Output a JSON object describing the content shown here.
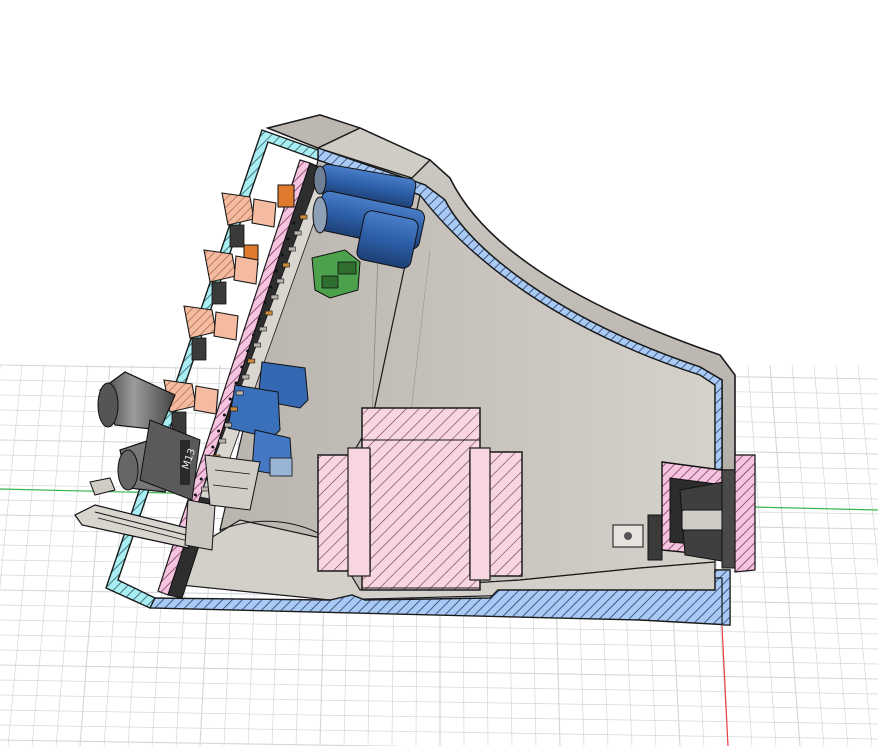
{
  "scene": {
    "kind": "cad-section-view",
    "colors": {
      "background": "#ffffff",
      "grid_line": "#d2d6dc",
      "axis_red": "#e64040",
      "axis_green": "#39b54a",
      "body_fill": "#d8d4ce",
      "body_dark": "#a7a29b",
      "body_interior": "#c5c0b8",
      "section_blue": "#9fc3f2",
      "section_cyan": "#9fe9ee",
      "section_pink": "#f4c0dc",
      "transformer_pink": "#f7d0dc",
      "knob_salmon": "#f2b699",
      "capacitor_blue": "#2d5fa8",
      "terminal_green": "#4ca24c",
      "trimmer_orange": "#e07a2c",
      "outline": "#1a1a1a"
    },
    "parts": [
      "enclosure-section",
      "front-panel-section",
      "circuit-board",
      "transformer",
      "electrolytic-capacitors",
      "terminal-block",
      "trimmer-potentiometers",
      "control-knobs",
      "rear-iec-inlet"
    ],
    "labels": {
      "lug_marking": "M13"
    }
  }
}
